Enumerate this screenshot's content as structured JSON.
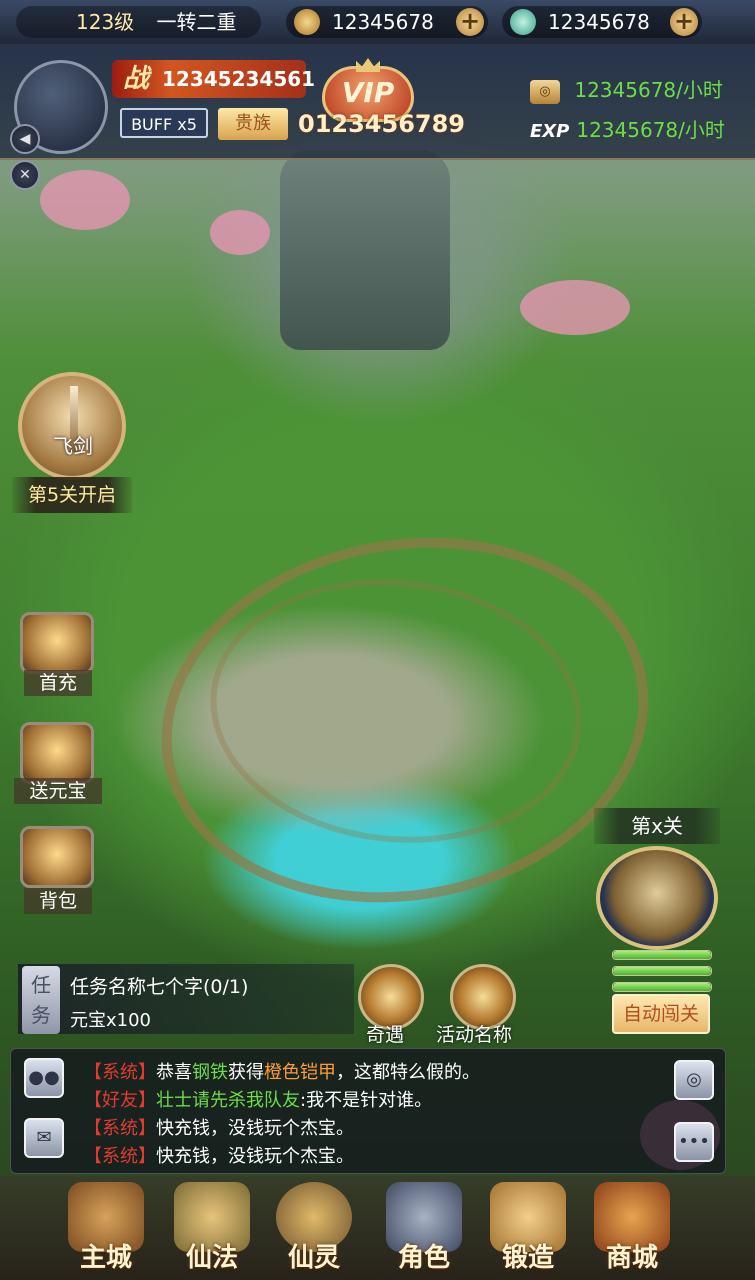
{
  "topbar": {
    "level": "123级",
    "rank": "一转二重",
    "gold": "12345678",
    "jade": "12345678",
    "plus_label": "+"
  },
  "player": {
    "power_prefix": "战",
    "power": "12345234561",
    "buff": "BUFF x5",
    "noble": "贵族",
    "vip_label": "VIP",
    "vip_value": "0123456789",
    "gold_rate": "12345678/小时",
    "exp_label": "EXP",
    "exp_rate": "12345678/小时"
  },
  "left_buttons": {
    "sound": "◀",
    "settings": "✕"
  },
  "feature_unlock": {
    "label": "飞剑",
    "unlock_text": "第5关开启"
  },
  "side_menu": [
    {
      "label": "首充"
    },
    {
      "label": "送元宝"
    },
    {
      "label": "背包"
    }
  ],
  "task": {
    "tab": "任务",
    "name": "任务名称七个字(0/1)",
    "reward": "元宝x100"
  },
  "events": [
    {
      "label": "奇遇"
    },
    {
      "label": "活动名称"
    }
  ],
  "stage": {
    "label": "第x关",
    "auto_button": "自动闯关"
  },
  "chat": {
    "lines": [
      {
        "channel": "【系统】",
        "segments": [
          {
            "text": "恭喜",
            "color": "#ffffff"
          },
          {
            "text": "钢铁",
            "color": "#6ddd46"
          },
          {
            "text": "获得",
            "color": "#ffffff"
          },
          {
            "text": "橙色铠甲",
            "color": "#ff9d2e"
          },
          {
            "text": "，这都特么假的。",
            "color": "#ffffff"
          }
        ]
      },
      {
        "channel": "【好友】",
        "segments": [
          {
            "text": "壮士请先杀我队友",
            "color": "#6ddd46"
          },
          {
            "text": ":我不是针对谁。",
            "color": "#ffffff"
          }
        ]
      },
      {
        "channel": "【系统】",
        "segments": [
          {
            "text": "快充钱，没钱玩个杰宝。",
            "color": "#ffffff"
          }
        ]
      },
      {
        "channel": "【系统】",
        "segments": [
          {
            "text": "快充钱，没钱玩个杰宝。",
            "color": "#ffffff"
          }
        ]
      }
    ],
    "channel_color": "#e23b2f"
  },
  "nav": [
    {
      "label": "主城",
      "icon": "city-icon"
    },
    {
      "label": "仙法",
      "icon": "magic-icon"
    },
    {
      "label": "仙灵",
      "icon": "spirit-icon"
    },
    {
      "label": "角色",
      "icon": "character-icon"
    },
    {
      "label": "锻造",
      "icon": "forge-icon"
    },
    {
      "label": "商城",
      "icon": "shop-icon"
    }
  ],
  "colors": {
    "accent_gold": "#caa562",
    "green_text": "#6ddd46",
    "unlock_text": "#ffe99f"
  }
}
